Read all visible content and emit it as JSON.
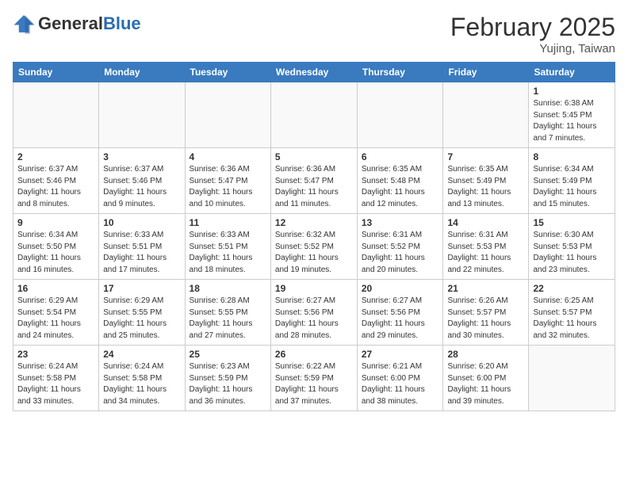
{
  "header": {
    "logo_general": "General",
    "logo_blue": "Blue",
    "month": "February 2025",
    "location": "Yujing, Taiwan"
  },
  "days_of_week": [
    "Sunday",
    "Monday",
    "Tuesday",
    "Wednesday",
    "Thursday",
    "Friday",
    "Saturday"
  ],
  "weeks": [
    [
      {
        "day": "",
        "info": ""
      },
      {
        "day": "",
        "info": ""
      },
      {
        "day": "",
        "info": ""
      },
      {
        "day": "",
        "info": ""
      },
      {
        "day": "",
        "info": ""
      },
      {
        "day": "",
        "info": ""
      },
      {
        "day": "1",
        "info": "Sunrise: 6:38 AM\nSunset: 5:45 PM\nDaylight: 11 hours and 7 minutes."
      }
    ],
    [
      {
        "day": "2",
        "info": "Sunrise: 6:37 AM\nSunset: 5:46 PM\nDaylight: 11 hours and 8 minutes."
      },
      {
        "day": "3",
        "info": "Sunrise: 6:37 AM\nSunset: 5:46 PM\nDaylight: 11 hours and 9 minutes."
      },
      {
        "day": "4",
        "info": "Sunrise: 6:36 AM\nSunset: 5:47 PM\nDaylight: 11 hours and 10 minutes."
      },
      {
        "day": "5",
        "info": "Sunrise: 6:36 AM\nSunset: 5:47 PM\nDaylight: 11 hours and 11 minutes."
      },
      {
        "day": "6",
        "info": "Sunrise: 6:35 AM\nSunset: 5:48 PM\nDaylight: 11 hours and 12 minutes."
      },
      {
        "day": "7",
        "info": "Sunrise: 6:35 AM\nSunset: 5:49 PM\nDaylight: 11 hours and 13 minutes."
      },
      {
        "day": "8",
        "info": "Sunrise: 6:34 AM\nSunset: 5:49 PM\nDaylight: 11 hours and 15 minutes."
      }
    ],
    [
      {
        "day": "9",
        "info": "Sunrise: 6:34 AM\nSunset: 5:50 PM\nDaylight: 11 hours and 16 minutes."
      },
      {
        "day": "10",
        "info": "Sunrise: 6:33 AM\nSunset: 5:51 PM\nDaylight: 11 hours and 17 minutes."
      },
      {
        "day": "11",
        "info": "Sunrise: 6:33 AM\nSunset: 5:51 PM\nDaylight: 11 hours and 18 minutes."
      },
      {
        "day": "12",
        "info": "Sunrise: 6:32 AM\nSunset: 5:52 PM\nDaylight: 11 hours and 19 minutes."
      },
      {
        "day": "13",
        "info": "Sunrise: 6:31 AM\nSunset: 5:52 PM\nDaylight: 11 hours and 20 minutes."
      },
      {
        "day": "14",
        "info": "Sunrise: 6:31 AM\nSunset: 5:53 PM\nDaylight: 11 hours and 22 minutes."
      },
      {
        "day": "15",
        "info": "Sunrise: 6:30 AM\nSunset: 5:53 PM\nDaylight: 11 hours and 23 minutes."
      }
    ],
    [
      {
        "day": "16",
        "info": "Sunrise: 6:29 AM\nSunset: 5:54 PM\nDaylight: 11 hours and 24 minutes."
      },
      {
        "day": "17",
        "info": "Sunrise: 6:29 AM\nSunset: 5:55 PM\nDaylight: 11 hours and 25 minutes."
      },
      {
        "day": "18",
        "info": "Sunrise: 6:28 AM\nSunset: 5:55 PM\nDaylight: 11 hours and 27 minutes."
      },
      {
        "day": "19",
        "info": "Sunrise: 6:27 AM\nSunset: 5:56 PM\nDaylight: 11 hours and 28 minutes."
      },
      {
        "day": "20",
        "info": "Sunrise: 6:27 AM\nSunset: 5:56 PM\nDaylight: 11 hours and 29 minutes."
      },
      {
        "day": "21",
        "info": "Sunrise: 6:26 AM\nSunset: 5:57 PM\nDaylight: 11 hours and 30 minutes."
      },
      {
        "day": "22",
        "info": "Sunrise: 6:25 AM\nSunset: 5:57 PM\nDaylight: 11 hours and 32 minutes."
      }
    ],
    [
      {
        "day": "23",
        "info": "Sunrise: 6:24 AM\nSunset: 5:58 PM\nDaylight: 11 hours and 33 minutes."
      },
      {
        "day": "24",
        "info": "Sunrise: 6:24 AM\nSunset: 5:58 PM\nDaylight: 11 hours and 34 minutes."
      },
      {
        "day": "25",
        "info": "Sunrise: 6:23 AM\nSunset: 5:59 PM\nDaylight: 11 hours and 36 minutes."
      },
      {
        "day": "26",
        "info": "Sunrise: 6:22 AM\nSunset: 5:59 PM\nDaylight: 11 hours and 37 minutes."
      },
      {
        "day": "27",
        "info": "Sunrise: 6:21 AM\nSunset: 6:00 PM\nDaylight: 11 hours and 38 minutes."
      },
      {
        "day": "28",
        "info": "Sunrise: 6:20 AM\nSunset: 6:00 PM\nDaylight: 11 hours and 39 minutes."
      },
      {
        "day": "",
        "info": ""
      }
    ]
  ]
}
